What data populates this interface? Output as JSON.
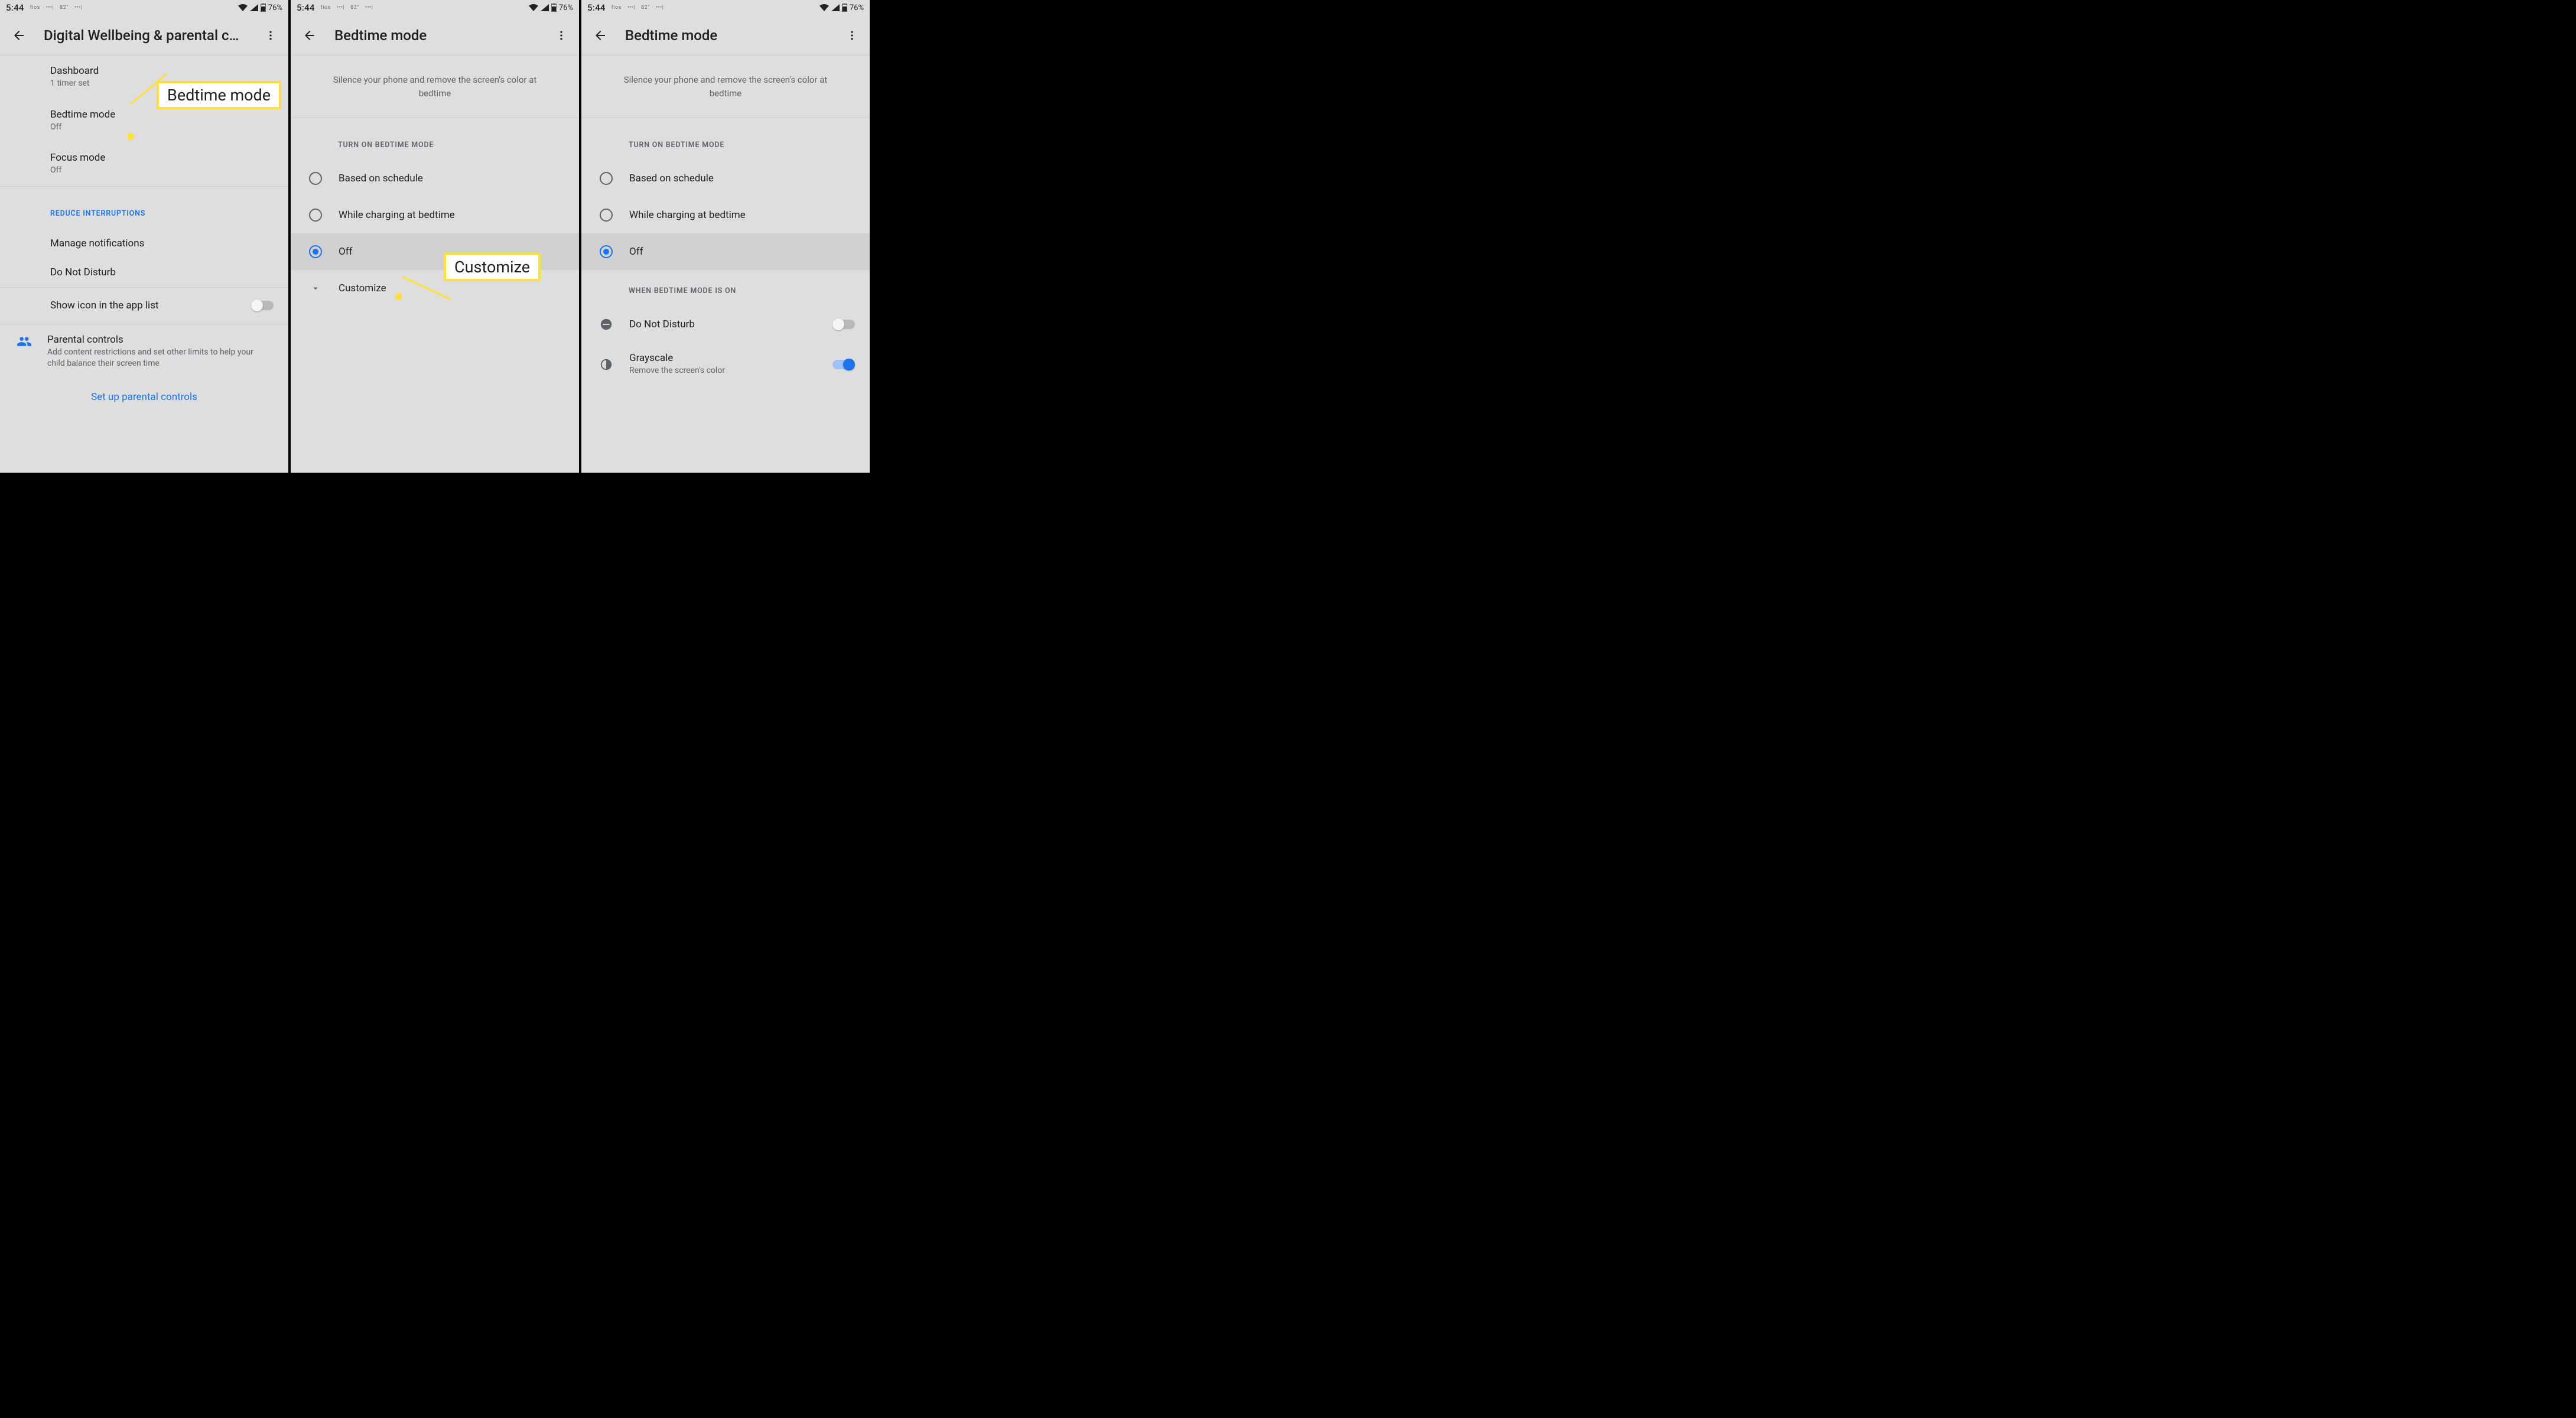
{
  "status": {
    "time": "5:44",
    "carrier": "fios",
    "temp": "82°",
    "battery": "76%"
  },
  "panel1": {
    "title": "Digital Wellbeing & parental c…",
    "dashboard_label": "Dashboard",
    "dashboard_sub": "1 timer set",
    "bedtime_label": "Bedtime mode",
    "bedtime_sub": "Off",
    "focus_label": "Focus mode",
    "focus_sub": "Off",
    "section_reduce": "REDUCE INTERRUPTIONS",
    "manage_notif": "Manage notifications",
    "dnd": "Do Not Disturb",
    "show_icon": "Show icon in the app list",
    "parental_title": "Parental controls",
    "parental_sub": "Add content restrictions and set other limits to help your child balance their screen time",
    "parental_link": "Set up parental controls",
    "callout": "Bedtime mode"
  },
  "panel2": {
    "title": "Bedtime mode",
    "subtitle": "Silence your phone and remove the screen's color at bedtime",
    "section_turnon": "TURN ON BEDTIME MODE",
    "opt_schedule": "Based on schedule",
    "opt_charging": "While charging at bedtime",
    "opt_off": "Off",
    "customize": "Customize",
    "callout": "Customize"
  },
  "panel3": {
    "title": "Bedtime mode",
    "subtitle": "Silence your phone and remove the screen's color at bedtime",
    "section_turnon": "TURN ON BEDTIME MODE",
    "opt_schedule": "Based on schedule",
    "opt_charging": "While charging at bedtime",
    "opt_off": "Off",
    "section_when": "WHEN BEDTIME MODE IS ON",
    "dnd": "Do Not Disturb",
    "grayscale": "Grayscale",
    "grayscale_sub": "Remove the screen's color"
  }
}
